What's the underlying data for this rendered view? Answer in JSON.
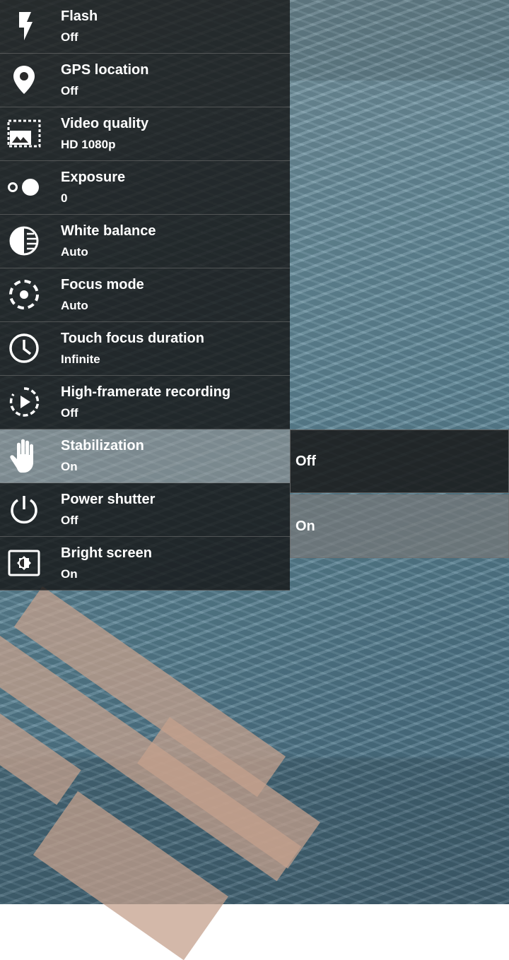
{
  "settings": [
    {
      "label": "Flash",
      "value": "Off",
      "icon": "flash-icon"
    },
    {
      "label": "GPS location",
      "value": "Off",
      "icon": "location-pin-icon"
    },
    {
      "label": "Video quality",
      "value": "HD 1080p",
      "icon": "video-quality-icon"
    },
    {
      "label": "Exposure",
      "value": "0",
      "icon": "exposure-icon"
    },
    {
      "label": "White balance",
      "value": "Auto",
      "icon": "white-balance-icon"
    },
    {
      "label": "Focus mode",
      "value": "Auto",
      "icon": "focus-icon"
    },
    {
      "label": "Touch focus duration",
      "value": "Infinite",
      "icon": "clock-icon"
    },
    {
      "label": "High-framerate recording",
      "value": "Off",
      "icon": "high-framerate-icon"
    },
    {
      "label": "Stabilization",
      "value": "On",
      "icon": "hand-icon",
      "selected": true
    },
    {
      "label": "Power shutter",
      "value": "Off",
      "icon": "power-icon"
    },
    {
      "label": "Bright screen",
      "value": "On",
      "icon": "bright-screen-icon"
    }
  ],
  "submenu": {
    "options": [
      "Off",
      "On"
    ]
  }
}
